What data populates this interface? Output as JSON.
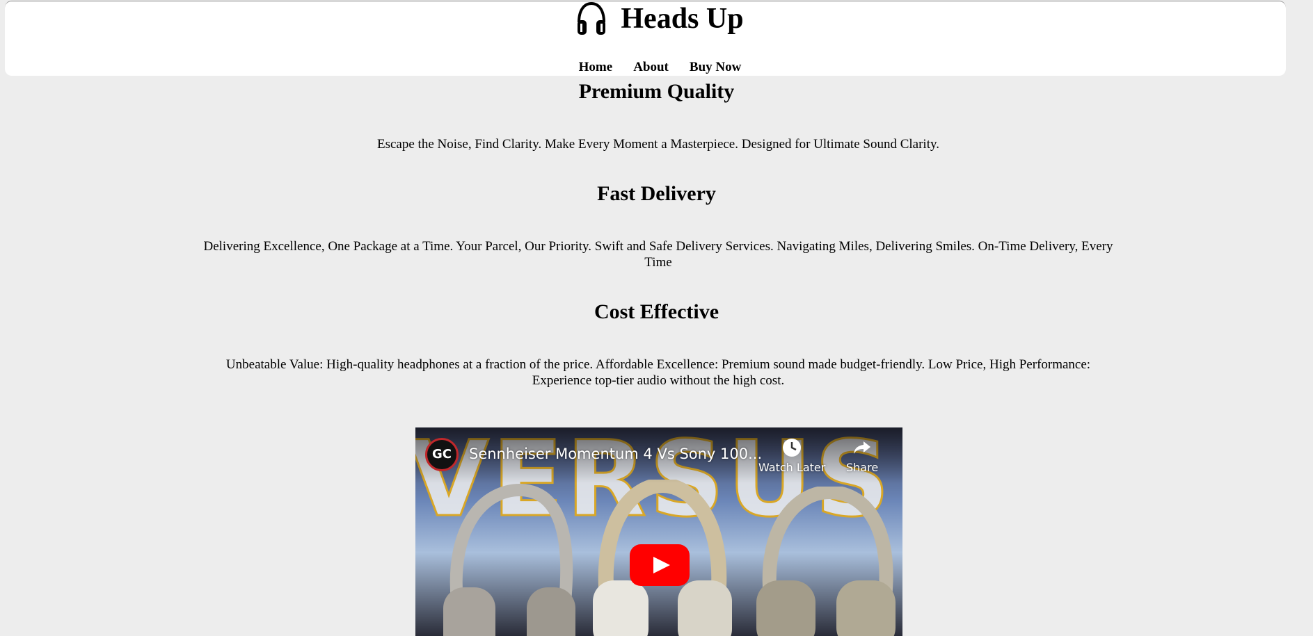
{
  "header": {
    "logo_icon": "headphones-icon",
    "title": "Heads Up",
    "nav": [
      {
        "label": "Home"
      },
      {
        "label": "About"
      },
      {
        "label": "Buy Now"
      }
    ]
  },
  "sections": [
    {
      "heading": "Premium Quality",
      "text": "Escape the Noise, Find Clarity. Make Every Moment a Masterpiece. Designed for Ultimate Sound Clarity."
    },
    {
      "heading": "Fast Delivery",
      "text": "Delivering Excellence, One Package at a Time. Your Parcel, Our Priority. Swift and Safe Delivery Services. Navigating Miles, Delivering Smiles. On-Time Delivery, Every Time"
    },
    {
      "heading": "Cost Effective",
      "text": "Unbeatable Value: High-quality headphones at a fraction of the price. Affordable Excellence: Premium sound made budget-friendly. Low Price, High Performance: Experience top-tier audio without the high cost."
    }
  ],
  "video": {
    "channel_badge": "GC",
    "title": "Sennheiser Momentum 4 Vs Sony 100...",
    "thumbnail_text": "VERSUS",
    "watch_later_label": "Watch Later",
    "share_label": "Share",
    "play_icon": "youtube-play-icon",
    "colors": {
      "play_button": "#ff0000",
      "avatar_ring": "#c0282b",
      "thumbnail_outline": "#d9a727"
    }
  },
  "colors": {
    "page_background": "#ededed",
    "header_background": "#ffffff"
  }
}
